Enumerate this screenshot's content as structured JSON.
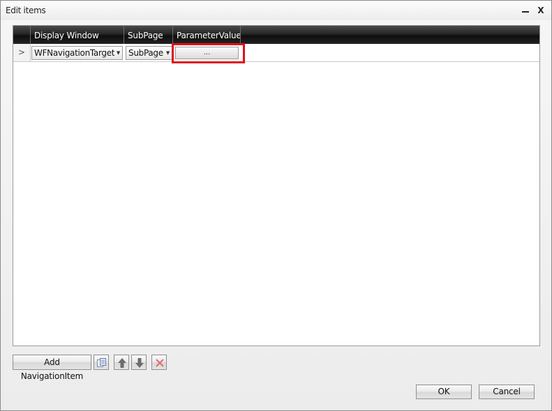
{
  "window": {
    "title": "Edit items",
    "minimize_glyph": "–",
    "close_glyph": "X"
  },
  "grid": {
    "columns": [
      "",
      "Display Window",
      "SubPage",
      "ParameterValues"
    ],
    "rows": [
      {
        "row_indicator": ">",
        "display_window": "WFNavigationTarget",
        "subpage": "SubPage",
        "parameter_values": "..."
      }
    ]
  },
  "toolbar": {
    "add_label": "Add NavigationItem",
    "icons": [
      "copy-icon",
      "arrow-up-icon",
      "arrow-down-icon",
      "delete-icon"
    ]
  },
  "footer": {
    "ok_label": "OK",
    "cancel_label": "Cancel"
  },
  "colors": {
    "header_bg": "#1a1a1a",
    "highlight": "#e0101a",
    "delete_icon": "#e04040"
  }
}
